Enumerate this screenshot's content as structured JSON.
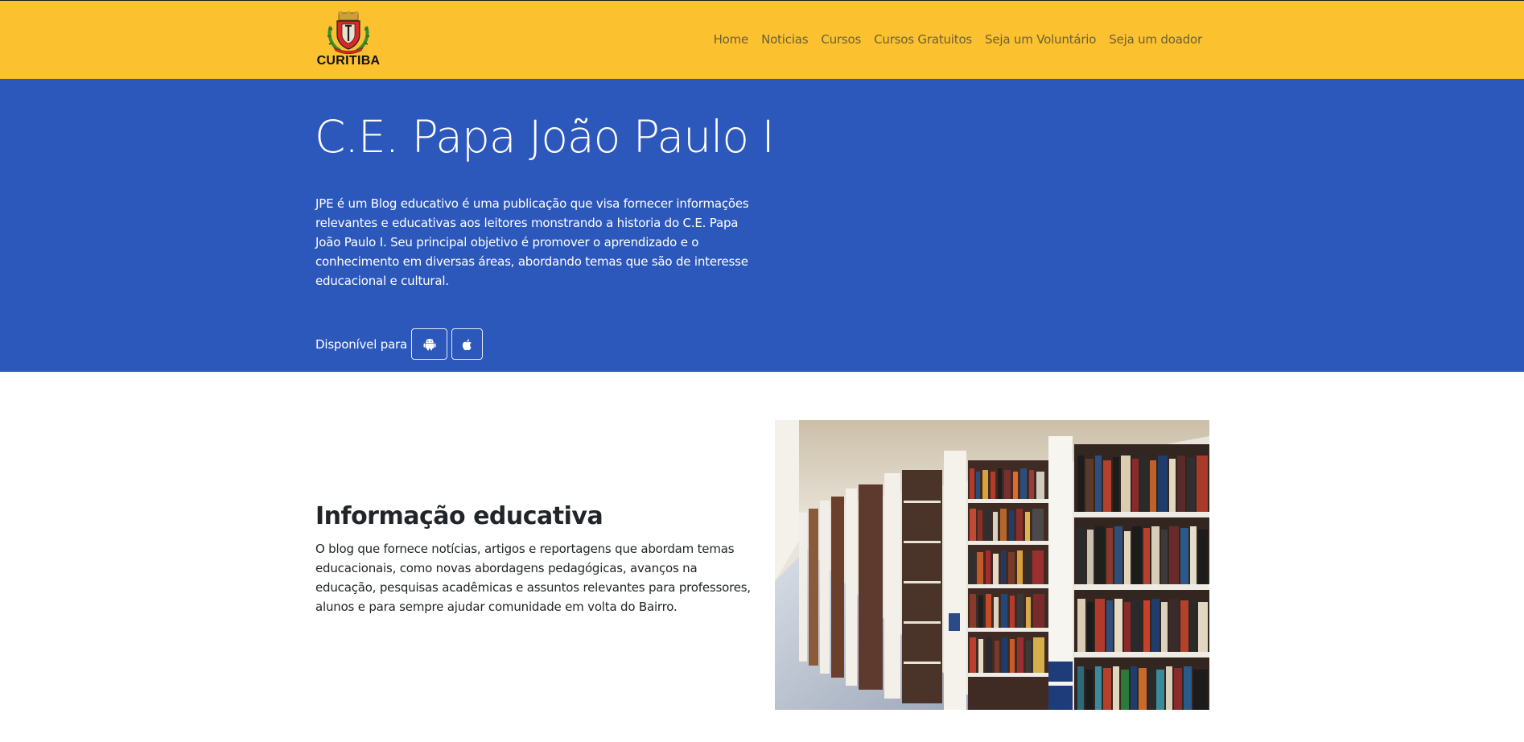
{
  "brand": {
    "name": "CURITIBA",
    "colors": {
      "navbar_bg": "#fcc12f",
      "hero_bg": "#2c58bb",
      "shield_red": "#d42a2a"
    }
  },
  "nav": {
    "items": [
      {
        "label": "Home"
      },
      {
        "label": "Noticias"
      },
      {
        "label": "Cursos"
      },
      {
        "label": "Cursos Gratuitos"
      },
      {
        "label": "Seja um Voluntário"
      },
      {
        "label": "Seja um doador"
      }
    ]
  },
  "hero": {
    "title": "C.E. Papa João Paulo I",
    "description": "JPE é um Blog educativo é uma publicação que visa fornecer informações relevantes e educativas aos leitores monstrando a historia do C.E. Papa João Paulo I. Seu principal objetivo é promover o aprendizado e o conhecimento em diversas áreas, abordando temas que são de interesse educacional e cultural.",
    "available_label": "Disponível para",
    "stores": [
      {
        "icon": "android-icon"
      },
      {
        "icon": "apple-icon"
      }
    ]
  },
  "info": {
    "title": "Informação educativa",
    "text": "O blog que fornece notícias, artigos e reportagens que abordam temas educacionais, como novas abordagens pedagógicas, avanços na educação, pesquisas acadêmicas e assuntos relevantes para professores, alunos e para sempre ajudar comunidade em volta do Bairro.",
    "image_icon": "library-bookshelves-image"
  }
}
